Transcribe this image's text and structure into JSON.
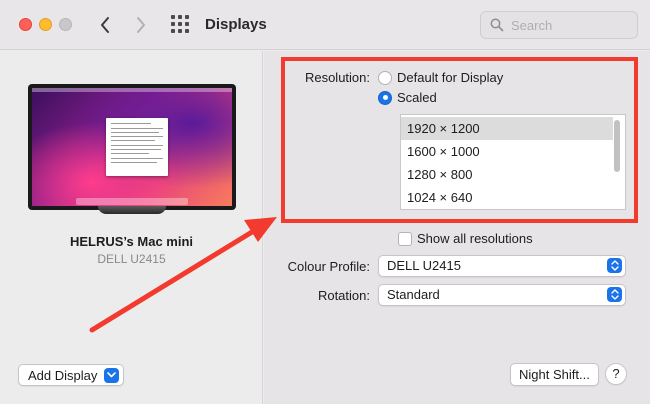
{
  "window": {
    "title": "Displays",
    "search_placeholder": "Search"
  },
  "display": {
    "name": "HELRUS’s Mac mini",
    "model": "DELL U2415",
    "add_display_label": "Add Display"
  },
  "resolution": {
    "label": "Resolution:",
    "option_default": "Default for Display",
    "option_scaled": "Scaled",
    "selected_option": "Scaled",
    "list": [
      "1920 × 1200",
      "1600 × 1000",
      "1280 × 800",
      "1024 × 640"
    ],
    "selected_index": 0,
    "show_all_label": "Show all resolutions",
    "show_all_checked": false
  },
  "colour_profile": {
    "label": "Colour Profile:",
    "value": "DELL U2415"
  },
  "rotation": {
    "label": "Rotation:",
    "value": "Standard"
  },
  "buttons": {
    "night_shift": "Night Shift...",
    "help": "?"
  },
  "colors": {
    "accent": "#1a73e8",
    "annotation": "#f23a2e"
  },
  "icons": {
    "back": "chevron-left-icon",
    "forward": "chevron-right-icon",
    "grid": "grid-icon",
    "search": "search-icon",
    "popup": "chevron-updown-icon"
  }
}
